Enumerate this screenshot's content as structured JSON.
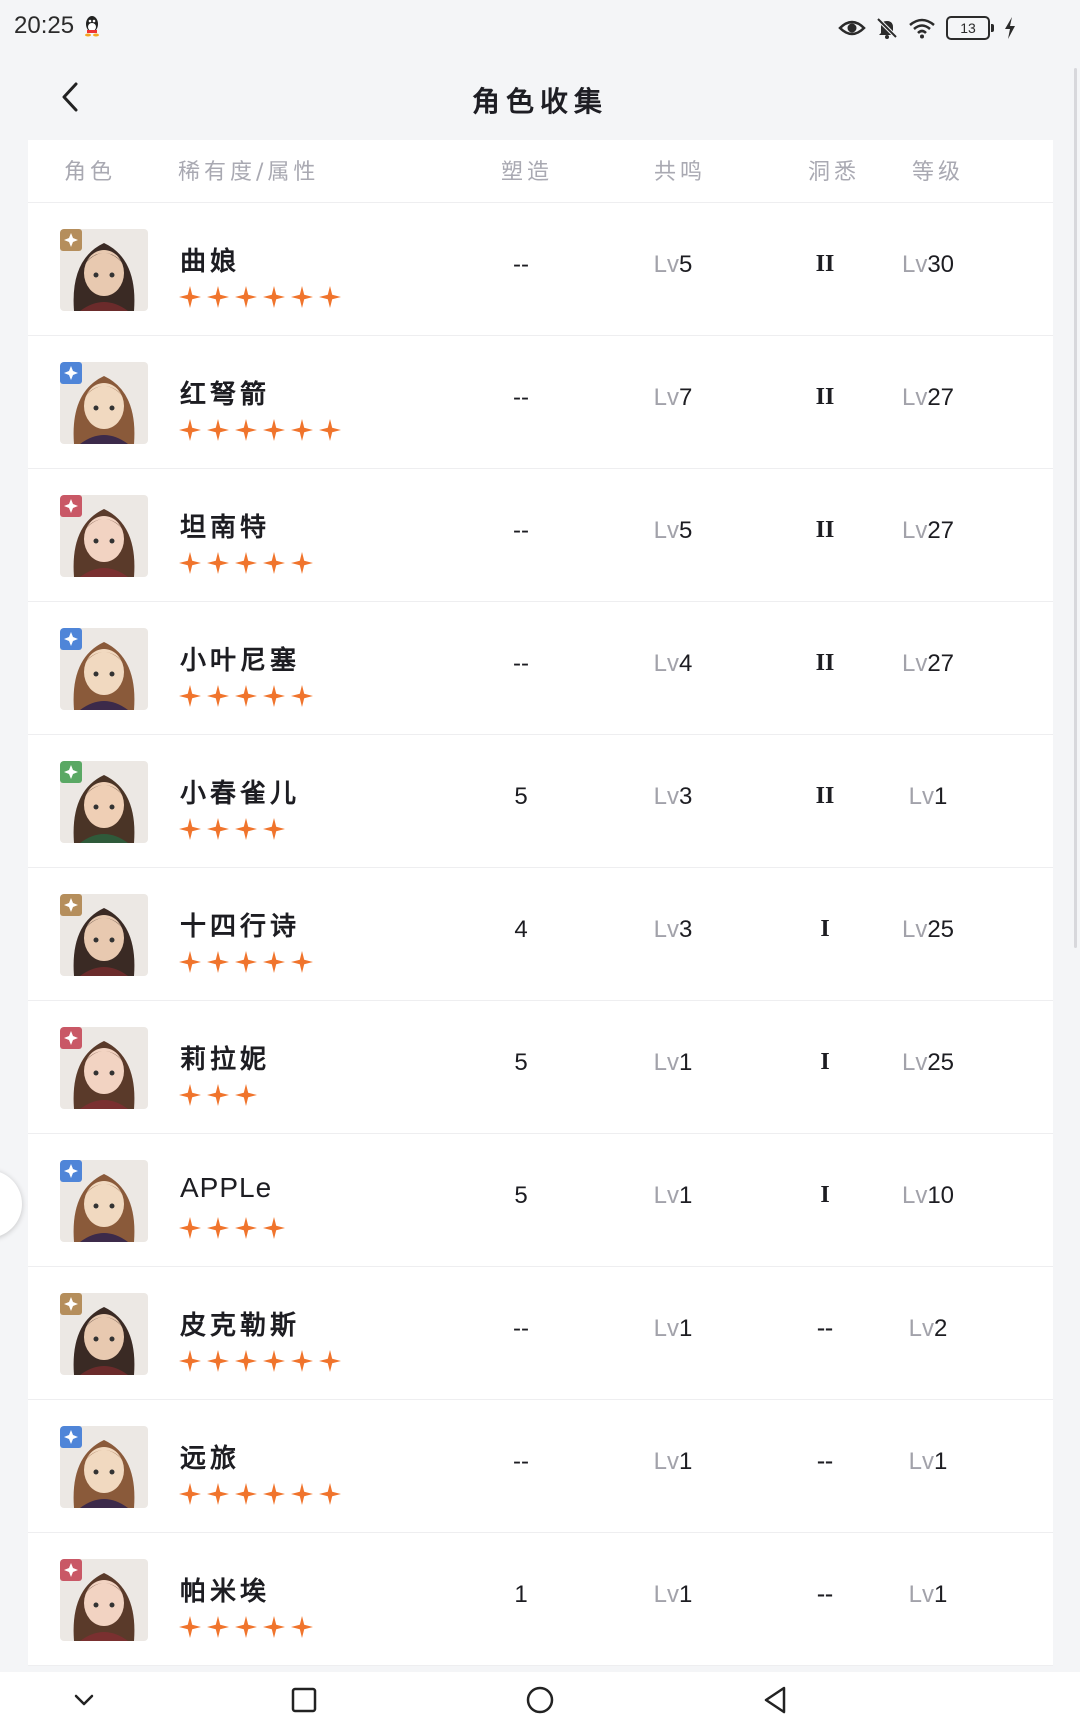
{
  "status_bar": {
    "time": "20:25",
    "battery": "13",
    "icons": [
      "qq-icon",
      "eye-icon",
      "bell-off-icon",
      "wifi-icon",
      "battery-icon",
      "charging-icon"
    ]
  },
  "header": {
    "title": "角色收集"
  },
  "table": {
    "columns": {
      "character": "角色",
      "rarity": "稀有度/属性",
      "shape": "塑造",
      "resonance": "共鸣",
      "insight": "洞悉",
      "level": "等级"
    },
    "rows": [
      {
        "name": "曲娘",
        "stars": 6,
        "element": "earth",
        "shape": "--",
        "resonance_prefix": "Lv",
        "resonance": "5",
        "insight": "II",
        "level_prefix": "Lv",
        "level": "30"
      },
      {
        "name": "红弩箭",
        "stars": 6,
        "element": "star",
        "shape": "--",
        "resonance_prefix": "Lv",
        "resonance": "7",
        "insight": "II",
        "level_prefix": "Lv",
        "level": "27"
      },
      {
        "name": "坦南特",
        "stars": 5,
        "element": "beast",
        "shape": "--",
        "resonance_prefix": "Lv",
        "resonance": "5",
        "insight": "II",
        "level_prefix": "Lv",
        "level": "27"
      },
      {
        "name": "小叶尼塞",
        "stars": 5,
        "element": "star",
        "shape": "--",
        "resonance_prefix": "Lv",
        "resonance": "4",
        "insight": "II",
        "level_prefix": "Lv",
        "level": "27"
      },
      {
        "name": "小春雀儿",
        "stars": 4,
        "element": "plant",
        "shape": "5",
        "resonance_prefix": "Lv",
        "resonance": "3",
        "insight": "II",
        "level_prefix": "Lv",
        "level": "1"
      },
      {
        "name": "十四行诗",
        "stars": 5,
        "element": "earth",
        "shape": "4",
        "resonance_prefix": "Lv",
        "resonance": "3",
        "insight": "I",
        "level_prefix": "Lv",
        "level": "25"
      },
      {
        "name": "莉拉妮",
        "stars": 3,
        "element": "beast",
        "shape": "5",
        "resonance_prefix": "Lv",
        "resonance": "1",
        "insight": "I",
        "level_prefix": "Lv",
        "level": "25"
      },
      {
        "name": "APPLe",
        "stars": 4,
        "element": "star",
        "shape": "5",
        "resonance_prefix": "Lv",
        "resonance": "1",
        "insight": "I",
        "level_prefix": "Lv",
        "level": "10"
      },
      {
        "name": "皮克勒斯",
        "stars": 6,
        "element": "earth",
        "shape": "--",
        "resonance_prefix": "Lv",
        "resonance": "1",
        "insight": "--",
        "level_prefix": "Lv",
        "level": "2"
      },
      {
        "name": "远旅",
        "stars": 6,
        "element": "star",
        "shape": "--",
        "resonance_prefix": "Lv",
        "resonance": "1",
        "insight": "--",
        "level_prefix": "Lv",
        "level": "1"
      },
      {
        "name": "帕米埃",
        "stars": 5,
        "element": "beast",
        "shape": "1",
        "resonance_prefix": "Lv",
        "resonance": "1",
        "insight": "--",
        "level_prefix": "Lv",
        "level": "1"
      }
    ]
  },
  "colors": {
    "star": "#f0742c",
    "earth": "#b58e5c",
    "star_elem": "#4f85d8",
    "beast": "#c95866",
    "plant": "#5aa864"
  },
  "nav_bar": {
    "icons": [
      "chevron-down-icon",
      "recents-icon",
      "home-icon",
      "back-triangle-icon"
    ]
  }
}
